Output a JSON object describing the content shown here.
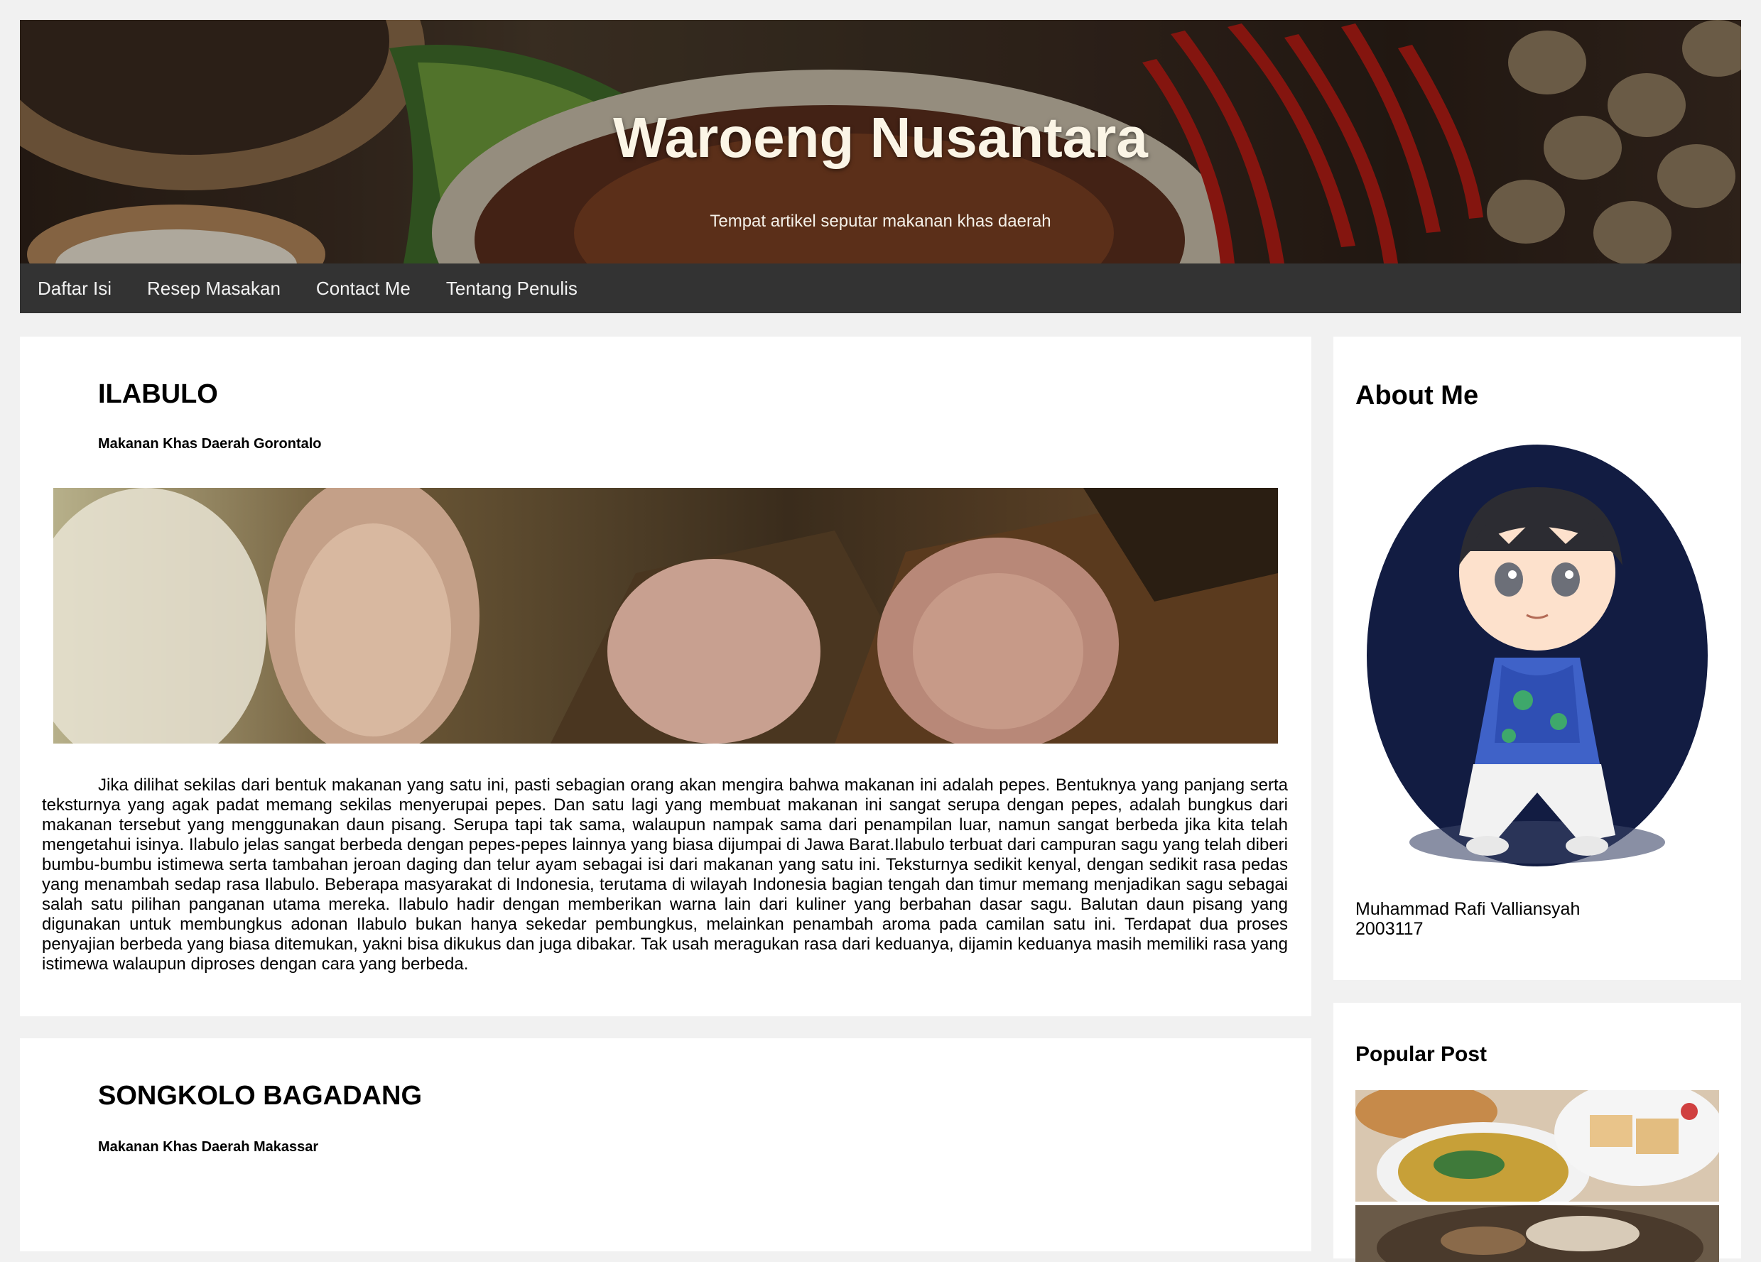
{
  "header": {
    "title": "Waroeng Nusantara",
    "subtitle": "Tempat artikel seputar makanan khas daerah"
  },
  "nav": {
    "items": [
      "Daftar Isi",
      "Resep Masakan",
      "Contact Me",
      "Tentang Penulis"
    ]
  },
  "posts": [
    {
      "title": "ILABULO",
      "subtitle": "Makanan Khas Daerah Gorontalo",
      "image_icon": "ilabulo-food-photo",
      "body": "Jika dilihat sekilas dari bentuk makanan yang satu ini, pasti sebagian orang akan mengira bahwa makanan ini adalah pepes. Bentuknya yang panjang serta teksturnya yang agak padat memang sekilas menyerupai pepes. Dan satu lagi yang membuat makanan ini sangat serupa dengan pepes, adalah bungkus dari makanan tersebut yang menggunakan daun pisang. Serupa tapi tak sama, walaupun nampak sama dari penampilan luar, namun sangat berbeda jika kita telah mengetahui isinya. Ilabulo jelas sangat berbeda dengan pepes-pepes lainnya yang biasa dijumpai di Jawa Barat.Ilabulo terbuat dari campuran sagu yang telah diberi bumbu-bumbu istimewa serta tambahan jeroan daging dan telur ayam sebagai isi dari makanan yang satu ini. Teksturnya sedikit kenyal, dengan sedikit rasa pedas yang menambah sedap rasa Ilabulo. Beberapa masyarakat di Indonesia, terutama di wilayah Indonesia bagian tengah dan timur memang menjadikan sagu sebagai salah satu pilihan panganan utama mereka. Ilabulo hadir dengan memberikan warna lain dari kuliner yang berbahan dasar sagu. Balutan daun pisang yang digunakan untuk membungkus adonan Ilabulo bukan hanya sekedar pembungkus, melainkan penambah aroma pada camilan satu ini. Terdapat dua proses penyajian berbeda yang biasa ditemukan, yakni bisa dikukus dan juga dibakar. Tak usah meragukan rasa dari keduanya, dijamin keduanya masih memiliki rasa yang istimewa walaupun diproses dengan cara yang berbeda."
    },
    {
      "title": "SONGKOLO BAGADANG",
      "subtitle": "Makanan Khas Daerah Makassar"
    }
  ],
  "sidebar": {
    "about": {
      "title": "About Me",
      "avatar_icon": "author-avatar",
      "name": "Muhammad Rafi Valliansyah",
      "id": "2003117"
    },
    "popular": {
      "title": "Popular Post",
      "images": [
        "popular-post-1-photo",
        "popular-post-2-photo"
      ]
    }
  },
  "colors": {
    "page_bg": "#f1f1f1",
    "nav_bg": "#333333",
    "nav_text": "#f2f2f2",
    "card_bg": "#ffffff",
    "avatar_bg": "#121c42"
  }
}
